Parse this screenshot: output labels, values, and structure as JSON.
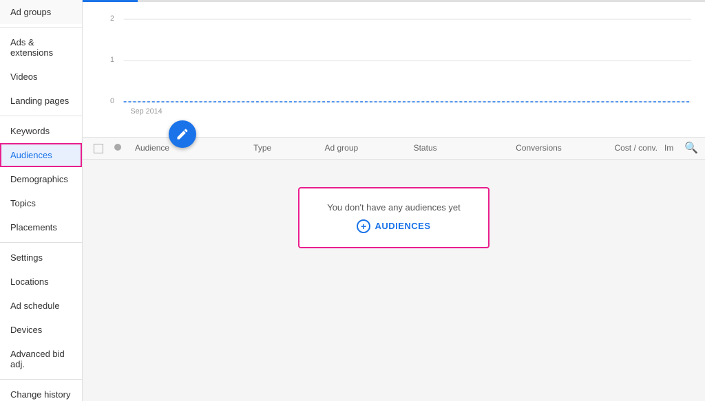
{
  "sidebar": {
    "items": [
      {
        "id": "ad-groups",
        "label": "Ad groups",
        "active": false,
        "divider_after": true
      },
      {
        "id": "ads-extensions",
        "label": "Ads & extensions",
        "active": false
      },
      {
        "id": "videos",
        "label": "Videos",
        "active": false
      },
      {
        "id": "landing-pages",
        "label": "Landing pages",
        "active": false,
        "divider_after": true
      },
      {
        "id": "keywords",
        "label": "Keywords",
        "active": false
      },
      {
        "id": "audiences",
        "label": "Audiences",
        "active": true,
        "highlighted": true
      },
      {
        "id": "demographics",
        "label": "Demographics",
        "active": false
      },
      {
        "id": "topics",
        "label": "Topics",
        "active": false
      },
      {
        "id": "placements",
        "label": "Placements",
        "active": false,
        "divider_after": true
      },
      {
        "id": "settings",
        "label": "Settings",
        "active": false
      },
      {
        "id": "locations",
        "label": "Locations",
        "active": false
      },
      {
        "id": "ad-schedule",
        "label": "Ad schedule",
        "active": false
      },
      {
        "id": "devices",
        "label": "Devices",
        "active": false
      },
      {
        "id": "advanced-bid",
        "label": "Advanced bid adj.",
        "active": false,
        "divider_after": true
      },
      {
        "id": "change-history",
        "label": "Change history",
        "active": false
      }
    ]
  },
  "chart": {
    "y_labels": [
      "2",
      "1",
      "0"
    ],
    "x_label": "Sep 2014",
    "tab_label": "Audiences"
  },
  "table": {
    "columns": [
      "Audience",
      "Type",
      "Ad group",
      "Status",
      "Conversions",
      "Cost / conv.",
      "Im"
    ],
    "search_icon": "🔍"
  },
  "empty_state": {
    "message": "You don't have any audiences yet",
    "button_label": "AUDIENCES",
    "button_plus": "+"
  }
}
